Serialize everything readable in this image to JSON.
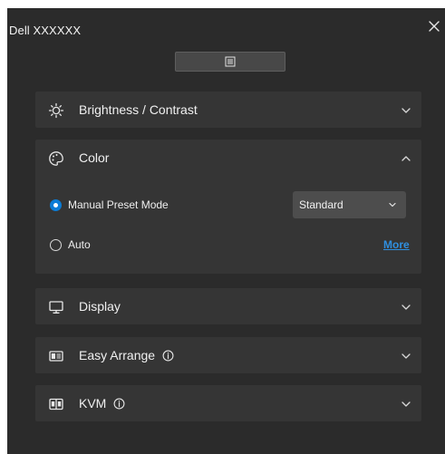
{
  "window": {
    "title": "Dell XXXXXX",
    "icons": {
      "close": "close-icon",
      "menu": "menu-list-icon"
    }
  },
  "sections": {
    "brightness": {
      "label": "Brightness / Contrast",
      "icon": "sun-icon",
      "expanded": false
    },
    "color": {
      "label": "Color",
      "icon": "palette-icon",
      "expanded": true,
      "options": {
        "manual": {
          "label": "Manual Preset Mode",
          "selected": true
        },
        "auto": {
          "label": "Auto",
          "selected": false
        }
      },
      "preset_select": {
        "value": "Standard"
      },
      "more_label": "More"
    },
    "display": {
      "label": "Display",
      "icon": "monitor-icon",
      "expanded": false
    },
    "easy_arrange": {
      "label": "Easy Arrange",
      "icon": "layout-icon",
      "expanded": false,
      "has_info": true
    },
    "kvm": {
      "label": "KVM",
      "icon": "kvm-icon",
      "expanded": false,
      "has_info": true
    }
  },
  "colors": {
    "window_bg": "#2b2b2b",
    "section_bg": "#353535",
    "accent": "#0b7cd6",
    "link": "#2f8fe0"
  }
}
